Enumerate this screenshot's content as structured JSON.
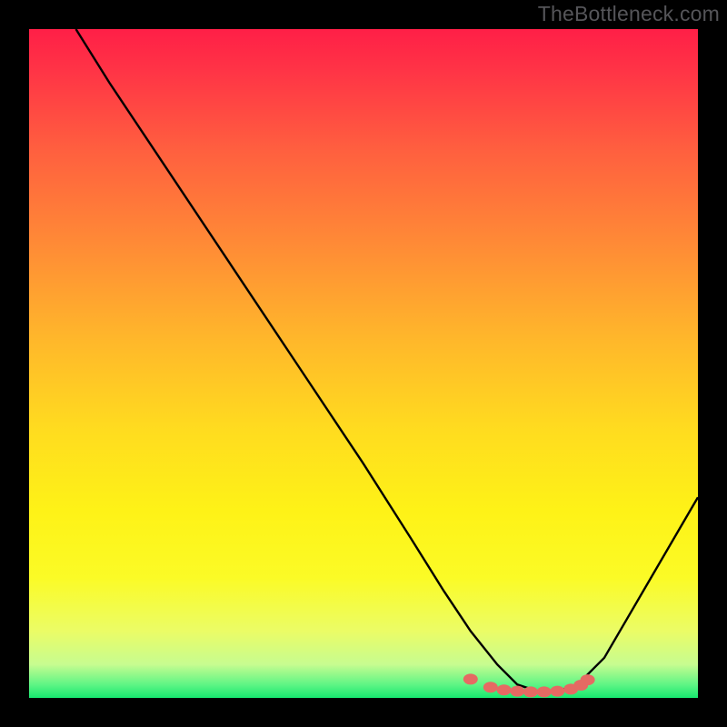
{
  "watermark": "TheBottleneck.com",
  "chart_data": {
    "type": "line",
    "title": "",
    "xlabel": "",
    "ylabel": "",
    "xlim": [
      0,
      100
    ],
    "ylim": [
      0,
      100
    ],
    "series": [
      {
        "name": "bottleneck-curve",
        "x": [
          7,
          12,
          20,
          30,
          40,
          50,
          57,
          62,
          66,
          70,
          73,
          76,
          79,
          82,
          86,
          100
        ],
        "y": [
          100,
          92,
          80,
          65,
          50,
          35,
          24,
          16,
          10,
          5,
          2,
          1,
          1,
          2,
          6,
          30
        ]
      }
    ],
    "marker_band": {
      "name": "optimal-range-dots",
      "x": [
        66,
        69,
        71,
        73,
        75,
        77,
        79,
        81,
        82.5,
        83.5
      ],
      "y": [
        2.8,
        1.6,
        1.2,
        1.0,
        0.9,
        0.9,
        1.0,
        1.3,
        1.9,
        2.7
      ]
    },
    "colors": {
      "curve": "#000000",
      "dots": "#e56a63",
      "gradient_top": "#ff1f47",
      "gradient_bottom": "#17e86f"
    }
  }
}
